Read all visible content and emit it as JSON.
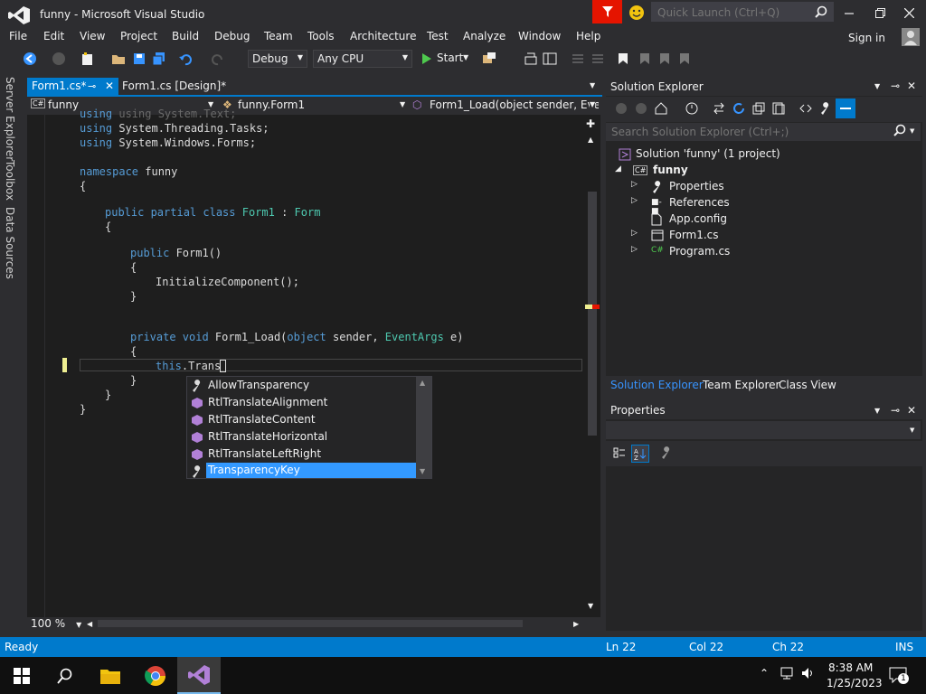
{
  "window": {
    "title": "funny - Microsoft Visual Studio"
  },
  "quick_launch": {
    "placeholder": "Quick Launch (Ctrl+Q)"
  },
  "menu": {
    "items": [
      "File",
      "Edit",
      "View",
      "Project",
      "Build",
      "Debug",
      "Team",
      "Tools",
      "Architecture",
      "Test",
      "Analyze",
      "Window",
      "Help"
    ],
    "signin": "Sign in"
  },
  "toolbar": {
    "config": "Debug",
    "platform": "Any CPU",
    "start": "Start"
  },
  "side_tabs": [
    "Server Explorer",
    "Toolbox",
    "Data Sources"
  ],
  "editor_tabs": [
    {
      "label": "Form1.cs*",
      "active": true
    },
    {
      "label": "Form1.cs [Design]*",
      "active": false
    }
  ],
  "nav": {
    "project": "funny",
    "class": "funny.Form1",
    "member": "Form1_Load(object sender, Even"
  },
  "code": {
    "line0": "using System.Text;",
    "line1": "using System.Threading.Tasks;",
    "line2": "using System.Windows.Forms;",
    "ns": "namespace funny",
    "brace": "{",
    "close": "}",
    "class_decl": "public partial class Form1 : Form",
    "ctor": "public Form1()",
    "init": "InitializeComponent();",
    "method": "private void Form1_Load(object sender, EventArgs e)",
    "current": "this.Trans"
  },
  "autocomplete": {
    "items": [
      {
        "label": "AllowTransparency",
        "icon": "wrench-icon",
        "selected": false
      },
      {
        "label": "RtlTranslateAlignment",
        "icon": "method-icon",
        "selected": false
      },
      {
        "label": "RtlTranslateContent",
        "icon": "method-icon",
        "selected": false
      },
      {
        "label": "RtlTranslateHorizontal",
        "icon": "method-icon",
        "selected": false
      },
      {
        "label": "RtlTranslateLeftRight",
        "icon": "method-icon",
        "selected": false
      },
      {
        "label": "TransparencyKey",
        "icon": "wrench-icon",
        "selected": true
      }
    ]
  },
  "zoom": "100 %",
  "solution_explorer": {
    "title": "Solution Explorer",
    "search_placeholder": "Search Solution Explorer (Ctrl+;)",
    "solution": "Solution 'funny' (1 project)",
    "project": "funny",
    "items": [
      "Properties",
      "References",
      "App.config",
      "Form1.cs",
      "Program.cs"
    ],
    "tabs": [
      "Solution Explorer",
      "Team Explorer",
      "Class View"
    ]
  },
  "properties": {
    "title": "Properties"
  },
  "status": {
    "state": "Ready",
    "line": "Ln 22",
    "col": "Col 22",
    "ch": "Ch 22",
    "mode": "INS"
  },
  "taskbar": {
    "time": "8:38 AM",
    "date": "1/25/2023",
    "notifications": "1"
  },
  "colors": {
    "accent": "#007acc",
    "selection": "#3399ff",
    "keyword": "#569cd6",
    "type": "#4ec9b0",
    "feedback": "#e51400"
  }
}
